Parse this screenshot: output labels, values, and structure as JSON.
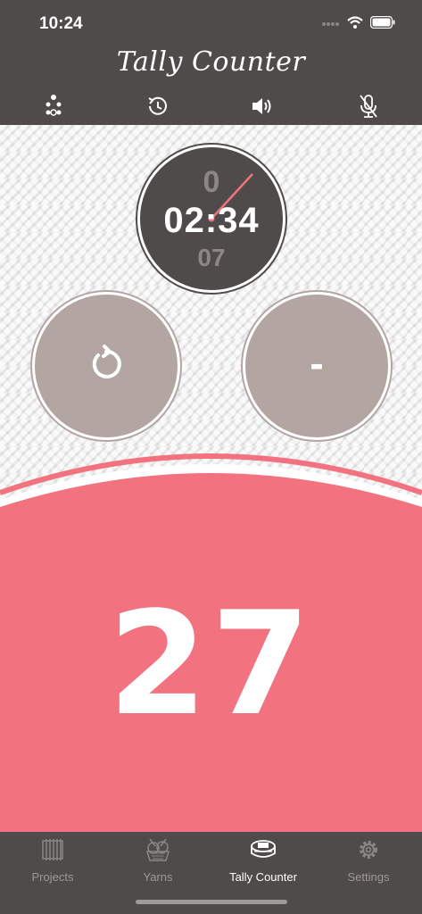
{
  "status_bar": {
    "time": "10:24"
  },
  "header": {
    "title": "Tally Counter"
  },
  "toolbar": {
    "icons": [
      "dots-menu-icon",
      "history-icon",
      "speaker-icon",
      "microphone-off-icon"
    ]
  },
  "timer": {
    "top": "0",
    "main": "02:34",
    "bottom": "07"
  },
  "buttons": {
    "reset_icon": "refresh-icon",
    "minus_label": "-"
  },
  "counter": {
    "value": "27"
  },
  "tabs": [
    {
      "label": "Projects",
      "icon": "knitting-needles-icon",
      "active": false
    },
    {
      "label": "Yarns",
      "icon": "yarn-basket-icon",
      "active": false
    },
    {
      "label": "Tally Counter",
      "icon": "tally-counter-icon",
      "active": true
    },
    {
      "label": "Settings",
      "icon": "gear-icon",
      "active": false
    }
  ],
  "colors": {
    "header_bg": "#4f4b4a",
    "accent_pink": "#f2727f",
    "button_taupe": "#b3a6a2",
    "knit_bg": "#ececec"
  }
}
